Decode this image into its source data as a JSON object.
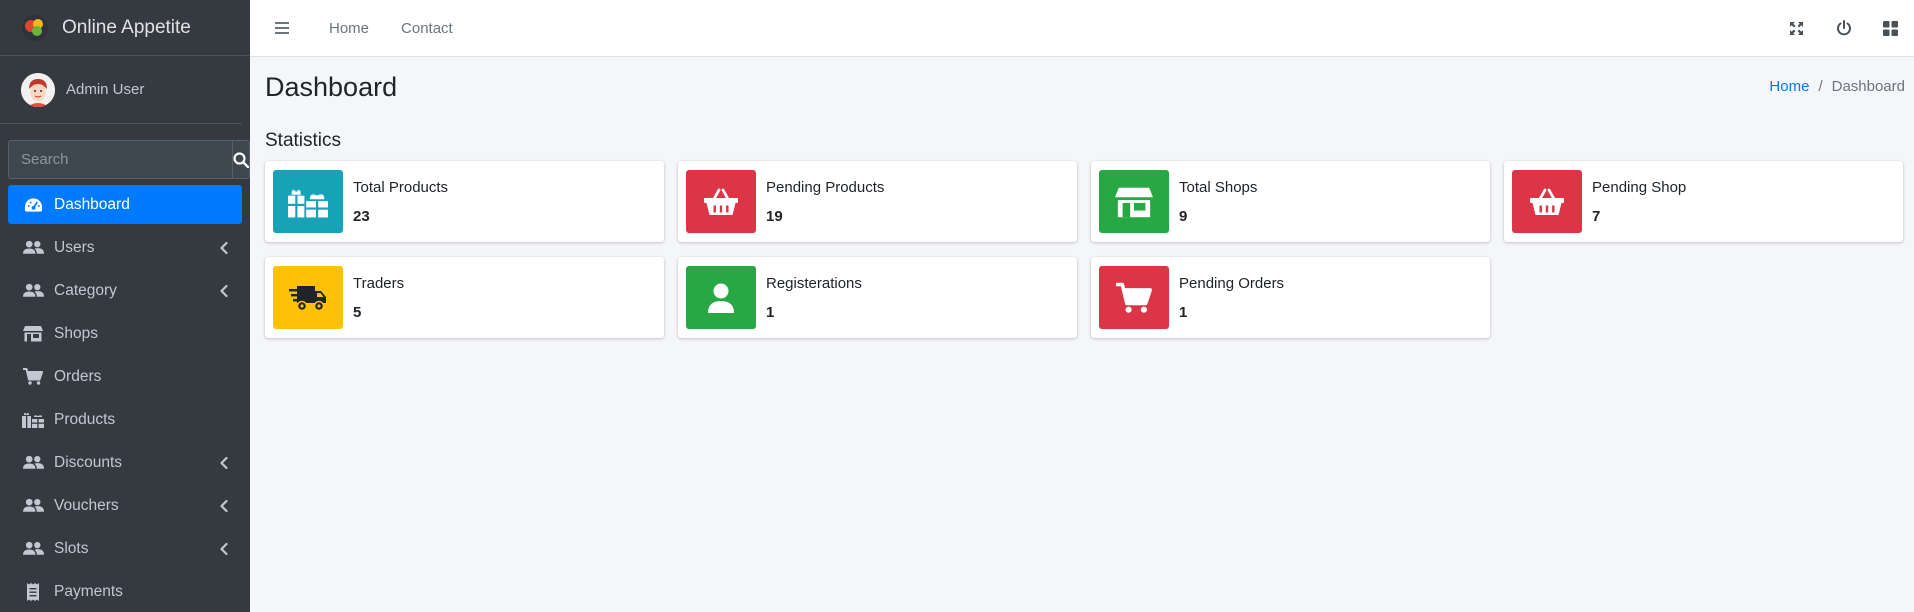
{
  "brand": {
    "name": "Online Appetite"
  },
  "user": {
    "name": "Admin User"
  },
  "search": {
    "placeholder": "Search"
  },
  "sidebar": {
    "items": [
      {
        "label": "Dashboard",
        "icon": "tachometer-icon",
        "active": true,
        "has_children": false
      },
      {
        "label": "Users",
        "icon": "users-icon",
        "active": false,
        "has_children": true
      },
      {
        "label": "Category",
        "icon": "users-icon",
        "active": false,
        "has_children": true
      },
      {
        "label": "Shops",
        "icon": "store-icon",
        "active": false,
        "has_children": false
      },
      {
        "label": "Orders",
        "icon": "cart-icon",
        "active": false,
        "has_children": false
      },
      {
        "label": "Products",
        "icon": "gifts-icon",
        "active": false,
        "has_children": false
      },
      {
        "label": "Discounts",
        "icon": "users-icon",
        "active": false,
        "has_children": true
      },
      {
        "label": "Vouchers",
        "icon": "users-icon",
        "active": false,
        "has_children": true
      },
      {
        "label": "Slots",
        "icon": "users-icon",
        "active": false,
        "has_children": true
      },
      {
        "label": "Payments",
        "icon": "receipt-icon",
        "active": false,
        "has_children": false
      }
    ]
  },
  "navbar": {
    "links": [
      "Home",
      "Contact"
    ],
    "right_icons": [
      "expand-icon",
      "power-icon",
      "grid-icon"
    ]
  },
  "page": {
    "title": "Dashboard",
    "breadcrumb": {
      "home": "Home",
      "current": "Dashboard"
    },
    "section_title": "Statistics"
  },
  "stats": [
    {
      "label": "Total Products",
      "value": "23",
      "color": "#17a2b8",
      "icon": "gifts-icon"
    },
    {
      "label": "Pending Products",
      "value": "19",
      "color": "#dc3545",
      "icon": "basket-icon"
    },
    {
      "label": "Total Shops",
      "value": "9",
      "color": "#28a745",
      "icon": "store-icon"
    },
    {
      "label": "Pending Shop",
      "value": "7",
      "color": "#dc3545",
      "icon": "basket-icon"
    },
    {
      "label": "Traders",
      "value": "5",
      "color": "#ffc107",
      "icon": "truck-icon"
    },
    {
      "label": "Registerations",
      "value": "1",
      "color": "#28a745",
      "icon": "user-icon"
    },
    {
      "label": "Pending Orders",
      "value": "1",
      "color": "#dc3545",
      "icon": "cart-icon"
    }
  ],
  "colors": {
    "sidebar_bg": "#343a40",
    "active": "#007bff",
    "content_bg": "#f4f6f9"
  }
}
